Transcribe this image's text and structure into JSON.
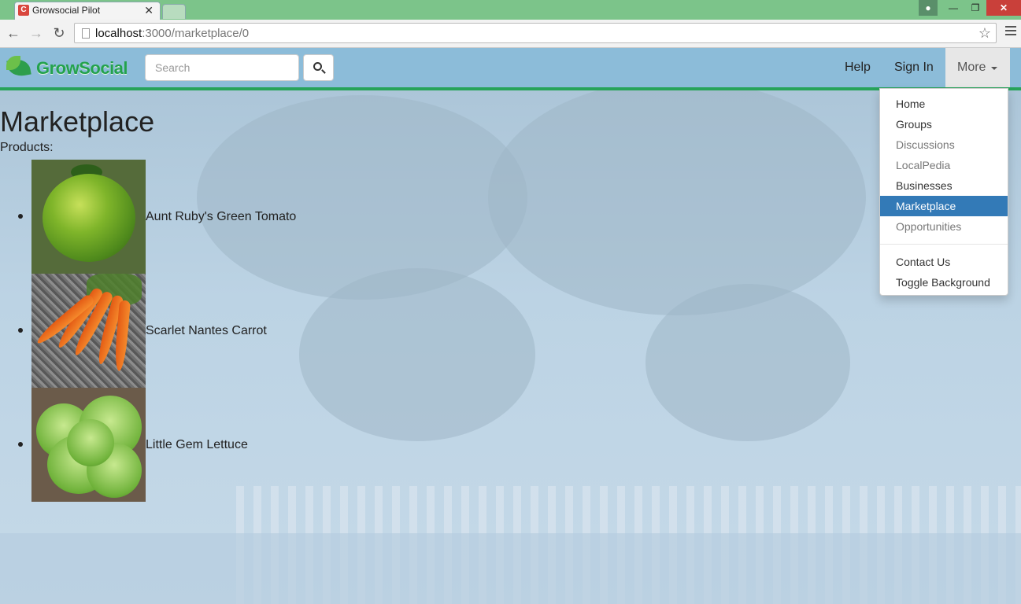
{
  "browser": {
    "tab_title": "Growsocial Pilot",
    "tab_favicon": "C",
    "url_host": "localhost",
    "url_path": ":3000/marketplace/0"
  },
  "navbar": {
    "brand": "GrowSocial",
    "search_placeholder": "Search",
    "help": "Help",
    "sign_in": "Sign In",
    "more": "More"
  },
  "dropdown": {
    "items": [
      {
        "label": "Home",
        "state": "normal"
      },
      {
        "label": "Groups",
        "state": "normal"
      },
      {
        "label": "Discussions",
        "state": "disabled"
      },
      {
        "label": "LocalPedia",
        "state": "disabled"
      },
      {
        "label": "Businesses",
        "state": "normal"
      },
      {
        "label": "Marketplace",
        "state": "active"
      },
      {
        "label": "Opportunities",
        "state": "disabled"
      }
    ],
    "secondary": [
      {
        "label": "Contact Us"
      },
      {
        "label": "Toggle Background"
      }
    ]
  },
  "main": {
    "title": "Marketplace",
    "products_label": "Products:",
    "products": [
      {
        "name": "Aunt Ruby's Green Tomato",
        "image": "green-tomato"
      },
      {
        "name": "Scarlet Nantes Carrot",
        "image": "carrots"
      },
      {
        "name": "Little Gem Lettuce",
        "image": "lettuce"
      }
    ]
  },
  "colors": {
    "tabstrip": "#7cc48a",
    "navbar": "#8cbcd9",
    "navbar_border": "#27a35a",
    "dropdown_active": "#337ab7",
    "brand": "#23a24d"
  }
}
